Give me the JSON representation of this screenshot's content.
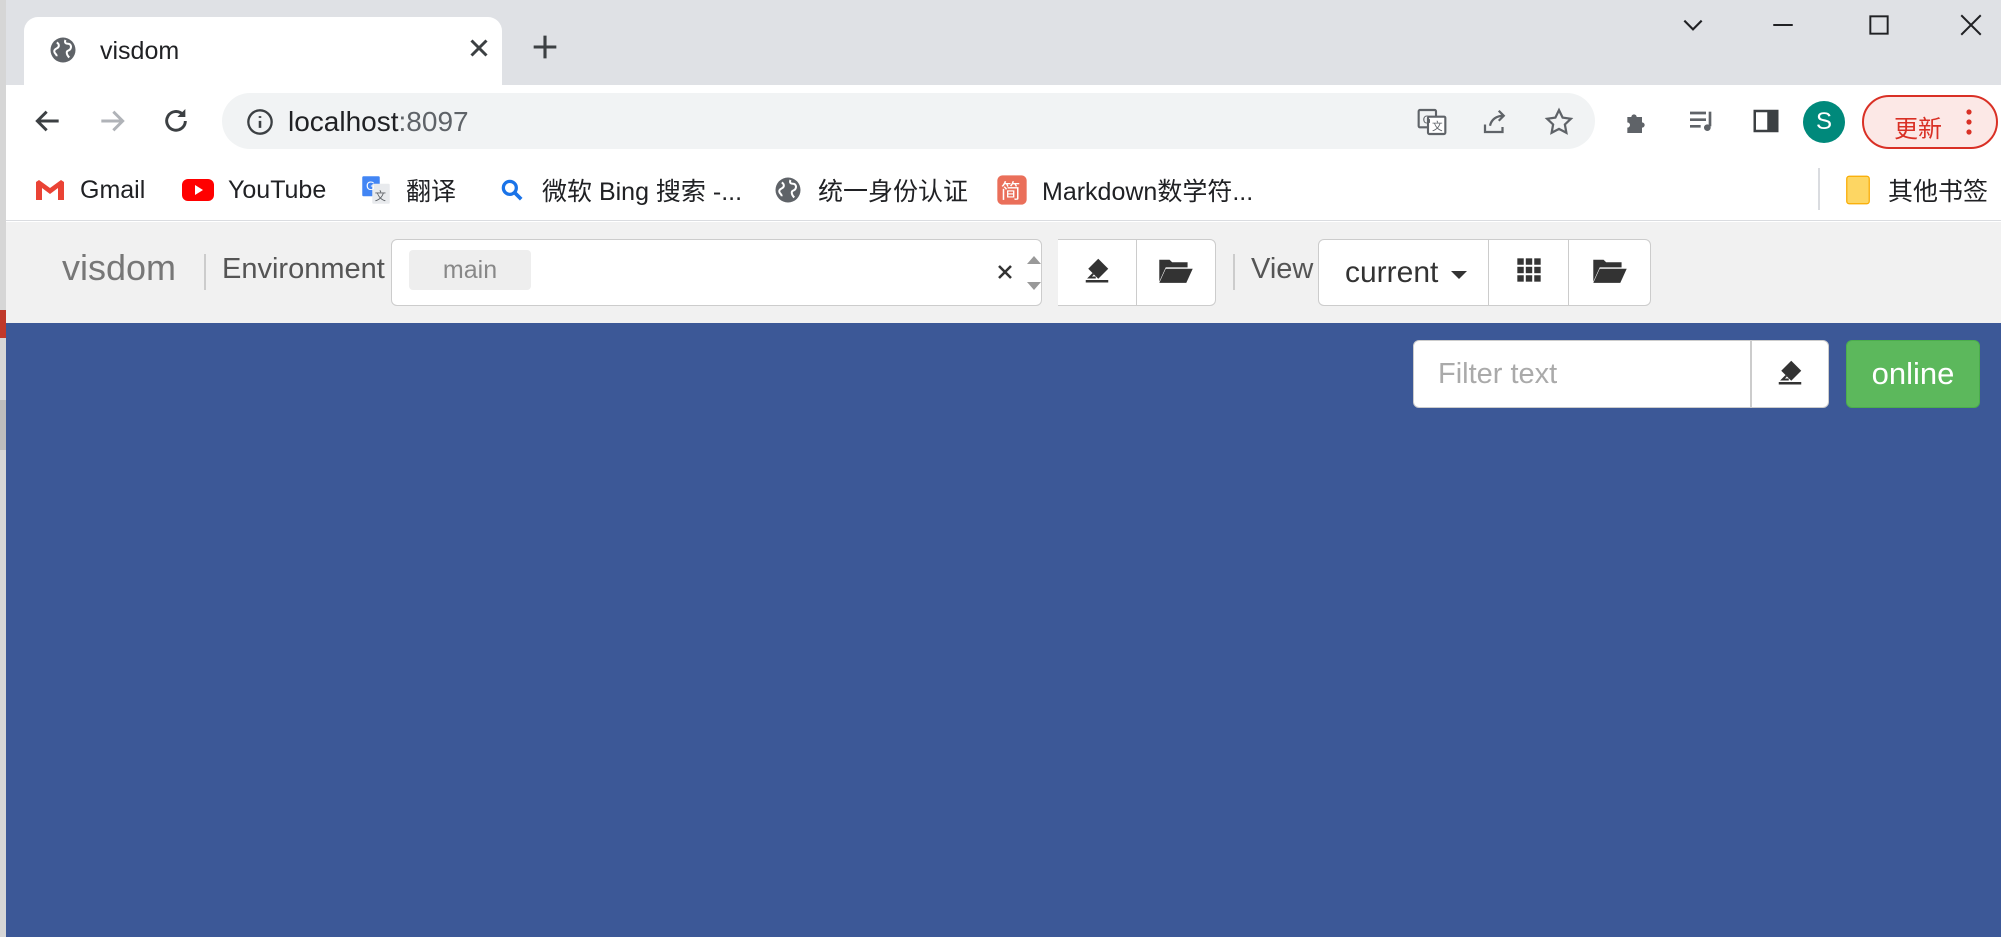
{
  "browser": {
    "tab": {
      "title": "visdom",
      "icon": "globe-icon"
    },
    "address": {
      "host": "localhost",
      "port": ":8097"
    },
    "profile_initial": "S",
    "update_label": "更新",
    "bookmarks": [
      {
        "label": "Gmail",
        "icon": "gmail-icon"
      },
      {
        "label": "YouTube",
        "icon": "youtube-icon"
      },
      {
        "label": "翻译",
        "icon": "translate-icon"
      },
      {
        "label": "微软 Bing 搜索 -...",
        "icon": "bing-search-icon"
      },
      {
        "label": "统一身份认证",
        "icon": "globe-icon"
      },
      {
        "label": "Markdown数学符...",
        "icon": "jianshu-icon"
      }
    ],
    "other_bookmarks": "其他书签"
  },
  "visdom": {
    "brand": "visdom",
    "environment_label": "Environment",
    "environment_chip": "main",
    "view_label": "View",
    "view_selected": "current",
    "filter_placeholder": "Filter text",
    "status_label": "online"
  },
  "colors": {
    "pane_bg": "#3c5897",
    "online_green": "#5cb85c",
    "navbar_bg": "#f1f1f1",
    "tabstrip_bg": "#dfe1e5"
  }
}
